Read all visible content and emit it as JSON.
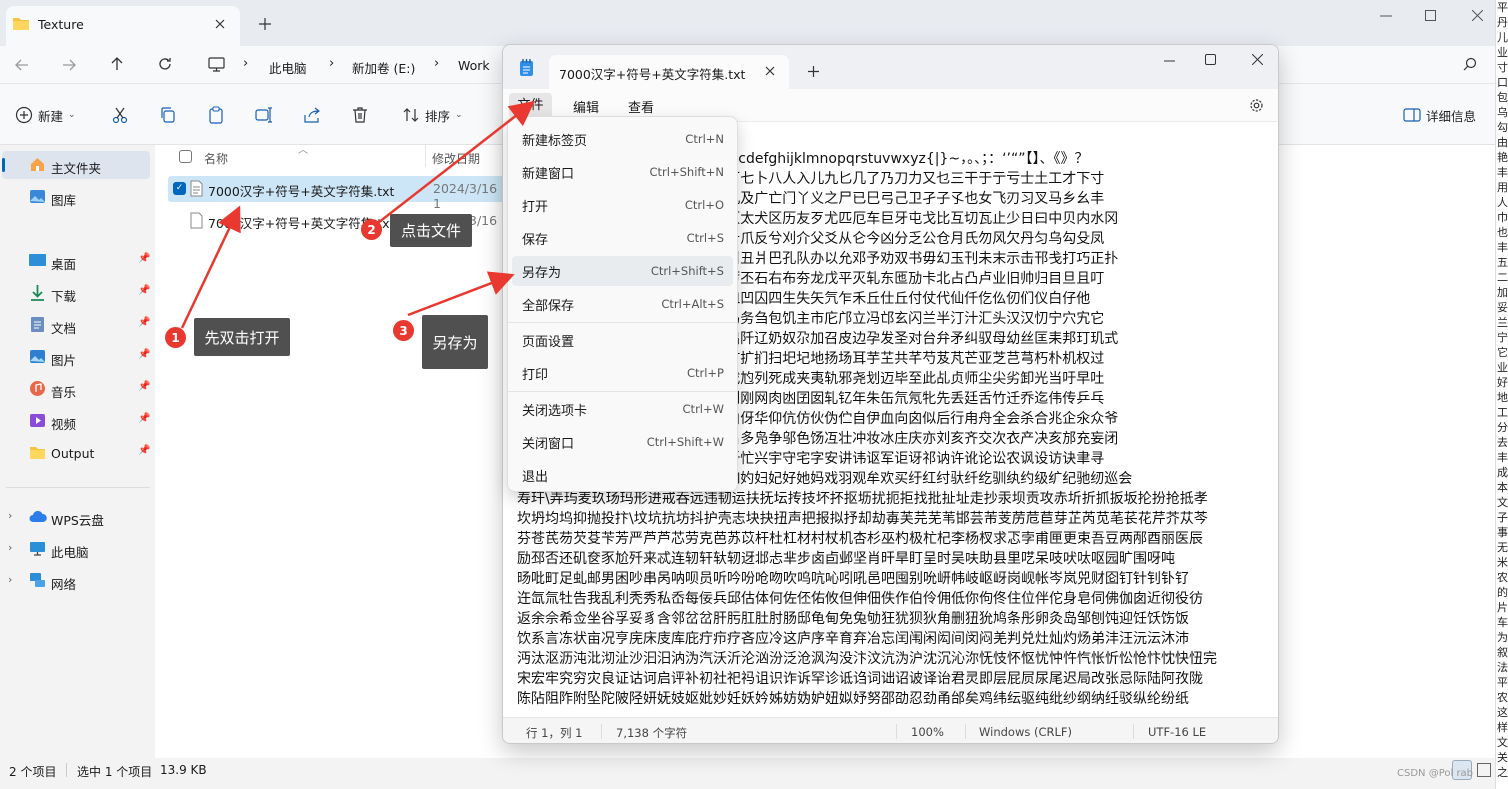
{
  "explorer": {
    "tab_title": "Texture",
    "breadcrumb": [
      "此电脑",
      "新加卷 (E:)",
      "Work"
    ],
    "toolbar": {
      "new": "新建",
      "sort": "排序",
      "details": "详细信息"
    },
    "sidebar": {
      "home": "主文件夹",
      "gallery": "图库",
      "pinned": [
        "桌面",
        "下载",
        "文档",
        "图片",
        "音乐",
        "视频",
        "Output"
      ],
      "cloud": "WPS云盘",
      "this_pc": "此电脑",
      "network": "网络"
    },
    "columns": {
      "name": "名称",
      "modified": "修改日期"
    },
    "files": [
      {
        "name": "7000汉字+符号+英文字符集.txt",
        "date": "2024/3/16 1",
        "selected": true
      },
      {
        "name": "7000汉字+符号+英文字符集.txt.meta",
        "date": "2024/3/16 1",
        "selected": false
      }
    ],
    "status": {
      "count": "2 个项目",
      "selection": "选中 1 个项目",
      "size": "13.9 KB"
    }
  },
  "notepad": {
    "tab_title": "7000汉字+符号+英文字符集.txt",
    "menu": [
      "文件",
      "编辑",
      "查看"
    ],
    "file_menu": [
      {
        "label": "新建标签页",
        "shortcut": "Ctrl+N"
      },
      {
        "label": "新建窗口",
        "shortcut": "Ctrl+Shift+N"
      },
      {
        "label": "打开",
        "shortcut": "Ctrl+O"
      },
      {
        "label": "保存",
        "shortcut": "Ctrl+S"
      },
      {
        "label": "另存为",
        "shortcut": "Ctrl+Shift+S"
      },
      {
        "label": "全部保存",
        "shortcut": "Ctrl+Alt+S"
      },
      {
        "label": "页面设置",
        "shortcut": ""
      },
      {
        "label": "打印",
        "shortcut": "Ctrl+P"
      },
      {
        "label": "关闭选项卡",
        "shortcut": "Ctrl+W"
      },
      {
        "label": "关闭窗口",
        "shortcut": "Ctrl+Shift+W"
      },
      {
        "label": "退出",
        "shortcut": ""
      }
    ],
    "content_lines": [
      "                         :;<=>?",
      "                         VWXYZ[\\]^_`abcdefghijklmnopqrstuvwxyz{|}~，。、；：‘’“”【】、《》？",
      "                         、乛一乙二十丁厂七卜八人入儿九匕几了乃刀力又乜三干于亍亏士土工才下寸",
      "                         亿个么久勺丸夕凡及广亡门丫义之尸已巳弓己卫孑子孓也女飞刃习叉马乡幺丰",
      "                         无木五支厅卅不仄太犬区历友歹尤匹厄车巨牙屯戈比互切瓦止少日曰中贝内水冈",
      "                         仉化仇币仍仂仅斤爪反兮刈介父爻从仑今凶分乏公仓月氏勿风欠丹匀乌勾殳凤",
      "                         认讥冗心尹尺夬引丑爿巴孔队办以允邓予劝双书毋幻玉刊未末示击邗戋打巧正扑",
      "                         术札可叵匝丙左厉丕石右布夯龙戊平灭轧东匜劢卡北占凸卢业旧帅归目旦且叮",
      "                         叩叩叻叨另叹冉皿凹囚四生失矢氕乍禾丘仕丘付仗代仙仟仡仫仞们仪白仔他",
      "                         犰册卯犯外处冬鸟务刍包饥主市庀邝立冯邙玄闪兰半汀汁汇头汉汉忉宁穴宄它",
      "                         尻尻尼民弗弘阢出阡辽奶奴尕加召皮边孕发圣对台弁矛纠驭母幼丝匡耒邦玎玑式",
      "                         寺托圳老圾巩执扩扩扪扫圯圮地扬场耳芋芏共芊芍芨芃芒亚芝芑芎朽朴机权过",
      "                         页匠夸夺夼灰达戍尥列死成夹夷轨邪尧划迈毕至此乩贞师尘尖劣卸光当吁早吐",
      "                         屹岌帆岁回岂屺则刚网肉凼囝囡轧钇年朱缶氘氖牝先丢廷舌竹迁乔迄伟传乒乓",
      "                         伢伤伥价伦伧伫伯伢华仰伉仿伙伪伫自伊血向囟似后行甪舟全会杀合兆企氽众爷",
      "                         爷刨旷匈犸舛各名多凫争邬色饧冱壮冲妆冰庄庆亦刘亥齐交次衣产决亥邡充妄闭",
      "                         汛汜池汝汤汉忖忏忙兴宇守宅字安讲讳讴军讵讶祁讷许讹论讼农讽设访诀聿寻",
      "                         那阶阴阱防丞奸如妁妇妃好她妈戏羽观牟欢买纡红纣驮纤纥驯纨约级纩纪驰纫巡会",
      "寿玕\\弄玙麦玖玚玛形进戒吞远违韧运扶抚坛抟技坏抔抠坜扰扼拒找批扯址走抄汞坝贡攻赤圻折抓扳坂抡扮抢抵孝",
      "坎坍均坞抑抛投抃\\坟坑抗坊抖护壳志块抉扭声把报拟抒却劫毐芙芫芜苇邯芸芾芰苈苊苣芽芷芮苋芼苌花芹芥苁芩",
      "芬苍芪芴芡芟苄芳严芦芦芯劳克芭苏苡杆杜杠材村杖机杏杉巫杓极杧杞李杨杈求忑孛甫匣更束吾豆两邴酉丽医辰",
      "励邳否还矶奁豕尬歼来忒连轫轩轪轫迓邶忐芈步卤卣邺坚肖旰旱盯呈时吴呋助县里呓呆吱吠呔呕园旷围呀吨",
      "旸吡町足虬邮男困吵串呙呐呗员听吟吩呛吻吹呜吭吣吲吼邑吧囤别吮岍帏岐岖岈岗岘帐岑岚兕财囵钉针钊钋钌",
      "迕氙氚牡告我乱利秃秀私岙每佞兵邱估体何佐伾佑攸但伸佃佚作伯伶佣低你佝佟住位伴佗身皂伺佛伽囱近彻役彷",
      "返余佘希佥坐谷孚妥豸含邻岔岔肝肟肛肚肘肠邸龟甸免兔劬狂犹狈狄角删狃狁鸠条彤卵灸岛邹刨饨迎饪饫饬饭",
      "饮系言冻状亩况亨庑床庋库庇疔疖疗吝应冷这庐序辛育弃冶忘闰闱闲闳间闵闷羌判兑灶灿灼炀弟沣汪沅沄沐沛",
      "沔汰沤沥沌沘沏沚沙汩汨汭沩汽沃沂沦汹汾泛沧沨沟没汴汶沆沩沪沈沉沁沵怃忮怀怄忧忡忤忾怅忻忪怆忭忱快忸完",
      "宋宏牢究穷灾良证诂诃启评补初社祀祃诅识诈诉罕诊诋诌词诎诏诐译诒君灵即层屁屃尿尾迟局改张忌际陆阿孜陇",
      "陈阽阻阼附坠陀陂陉妍妩妓妪妣妙妊妖妗姊妨妫妒妞姒妤努邵劭忍劲甬邰矣鸡纬纭驱纯纰纱纲纳纴驳纵纶纷纸"
    ],
    "status": {
      "position": "行 1，列 1",
      "chars": "7,138 个字符",
      "zoom": "100%",
      "eol": "Windows (CRLF)",
      "encoding": "UTF-16 LE"
    }
  },
  "annotations": [
    {
      "num": "1",
      "text": "先双击打开"
    },
    {
      "num": "2",
      "text": "点击文件"
    },
    {
      "num": "3",
      "text": "另存为"
    }
  ],
  "side_strip": "平丹儿业寸口包乌勾由艳丰用人巾也丰五二加妥兰宁它业好地工分去丰成本文子事无米农的片车为叙法平农这样文关之",
  "watermark": "CSDN @Pol rab",
  "colors": {
    "accent": "#0067c0",
    "annotation_red": "#e8382f",
    "callout_bg": "#505050",
    "arrow": "#e8382f"
  }
}
